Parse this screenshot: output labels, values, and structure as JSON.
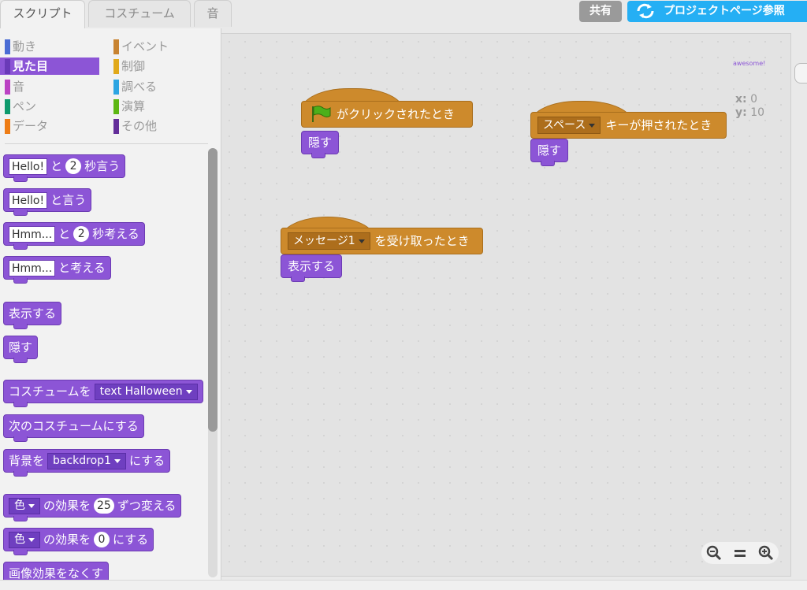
{
  "tabs": [
    {
      "label": "スクリプト",
      "active": true
    },
    {
      "label": "コスチューム",
      "active": false
    },
    {
      "label": "音",
      "active": false
    }
  ],
  "topbar": {
    "share_label": "共有",
    "see_project_label": "プロジェクトページ参照"
  },
  "categories": {
    "left": [
      {
        "label": "動き",
        "color": "#4a6cd4"
      },
      {
        "label": "見た目",
        "color": "#8a55d7",
        "selected": true
      },
      {
        "label": "音",
        "color": "#bb42c3"
      },
      {
        "label": "ペン",
        "color": "#0e9a6c"
      },
      {
        "label": "データ",
        "color": "#ee7d16"
      }
    ],
    "right": [
      {
        "label": "イベント",
        "color": "#c88330"
      },
      {
        "label": "制御",
        "color": "#e1a91a"
      },
      {
        "label": "調べる",
        "color": "#2ca5e2"
      },
      {
        "label": "演算",
        "color": "#5cb712"
      },
      {
        "label": "その他",
        "color": "#632d99"
      }
    ]
  },
  "palette": {
    "say_secs": {
      "text": "Hello!",
      "mid": "と",
      "num": "2",
      "end": "秒言う"
    },
    "say": {
      "text": "Hello!",
      "end": "と言う"
    },
    "think_secs": {
      "text": "Hmm...",
      "mid": "と",
      "num": "2",
      "end": "秒考える"
    },
    "think": {
      "text": "Hmm...",
      "end": "と考える"
    },
    "show": "表示する",
    "hide": "隠す",
    "switch_costume": {
      "label": "コスチュームを",
      "value": "text Halloween"
    },
    "next_costume": "次のコスチュームにする",
    "switch_backdrop": {
      "label": "背景を",
      "value": "backdrop1",
      "end": "にする"
    },
    "change_effect": {
      "value": "色",
      "mid": "の効果を",
      "num": "25",
      "end": "ずつ変える"
    },
    "set_effect": {
      "value": "色",
      "mid": "の効果を",
      "num": "0",
      "end": "にする"
    },
    "clear_effects": "画像効果をなくす"
  },
  "scripts": {
    "flag_hat": "がクリックされたとき",
    "flag_hide": "隠す",
    "key_hat": {
      "value": "スペース",
      "end": "キーが押されたとき"
    },
    "key_hide": "隠す",
    "msg_hat": {
      "value": "メッセージ1",
      "end": "を受け取ったとき"
    },
    "msg_show": "表示する"
  },
  "sprite_name": "awesome!",
  "coords": {
    "x_label": "x:",
    "x": "0",
    "y_label": "y:",
    "y": "10"
  },
  "zoom": {
    "out": "zoom-out",
    "reset": "=",
    "in": "zoom-in"
  }
}
